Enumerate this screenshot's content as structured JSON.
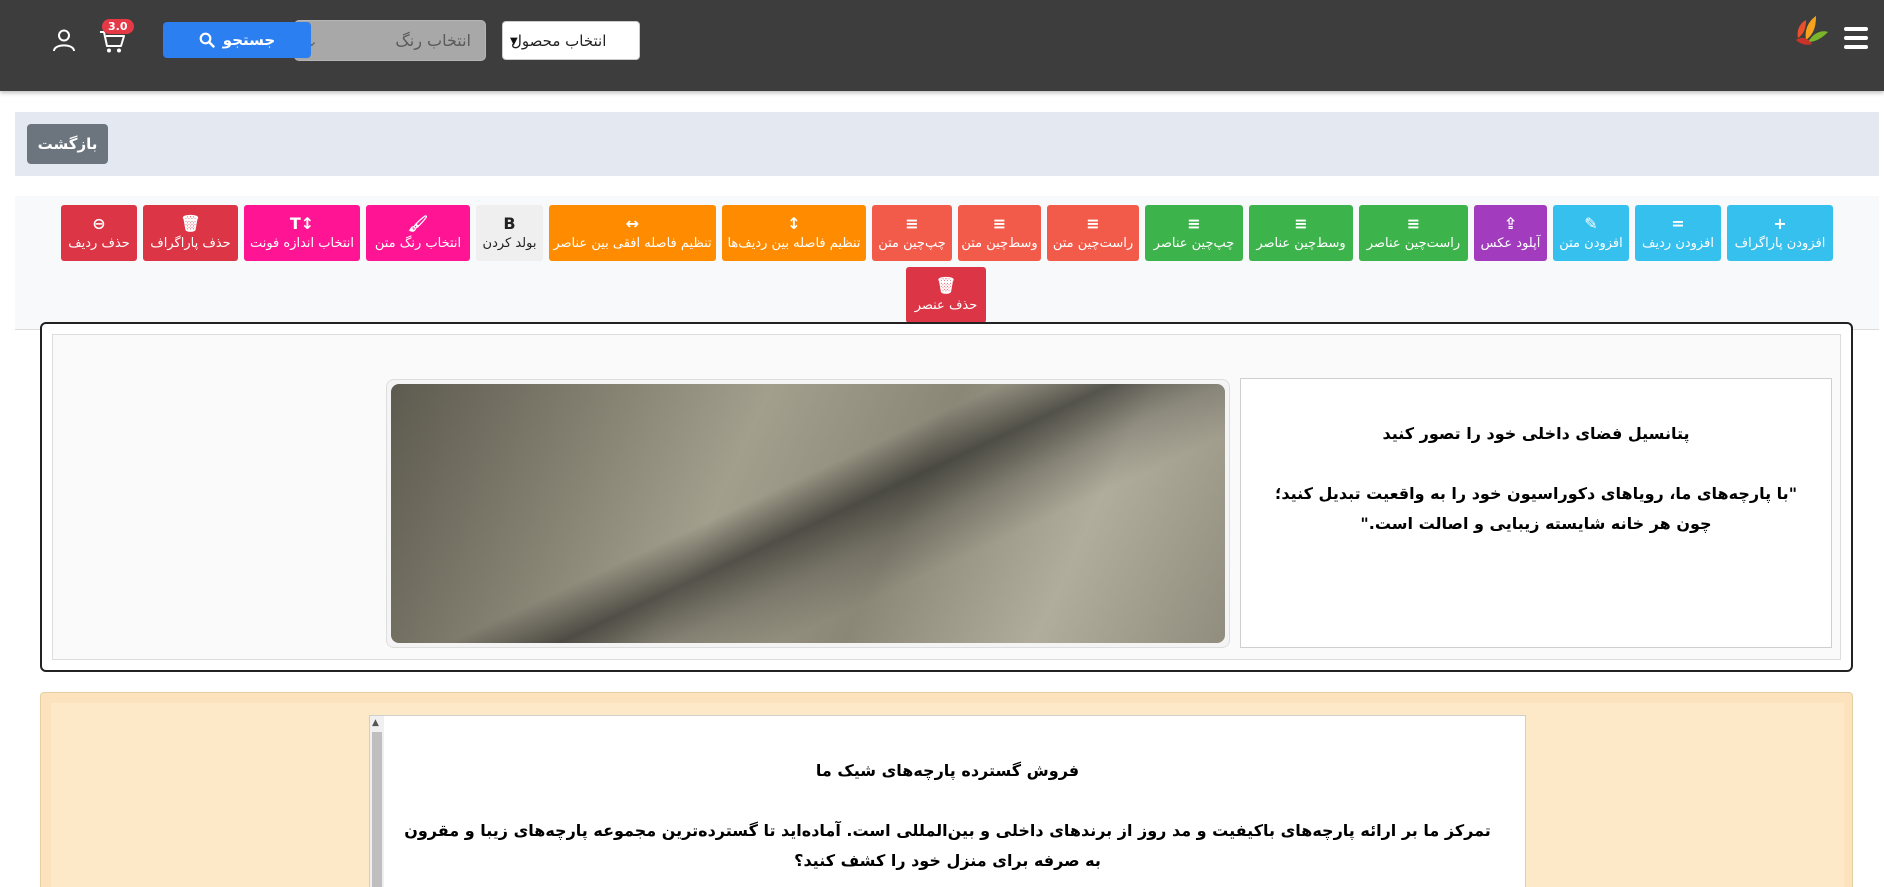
{
  "navbar": {
    "product_select": "انتخاب محصول",
    "color_select": "انتخاب رنگ",
    "search_label": "جستجو",
    "cart_badge": "3.0",
    "icons": [
      "hamburger-icon",
      "logo",
      "search-icon",
      "cart-icon",
      "user-icon"
    ]
  },
  "back_label": "بازگشت",
  "toolbar": {
    "row1": [
      {
        "label": "افزودن پاراگراف",
        "icon": "+",
        "color": "info"
      },
      {
        "label": "افزودن ردیف",
        "icon": "=",
        "color": "info"
      },
      {
        "label": "افزودن متن",
        "icon": "✎",
        "color": "info"
      },
      {
        "label": "آپلود عکس",
        "icon": "⇪",
        "color": "purple"
      },
      {
        "label": "راست‌چین عناصر",
        "icon": "≡",
        "color": "green"
      },
      {
        "label": "وسط‌چین عناصر",
        "icon": "≡",
        "color": "green"
      },
      {
        "label": "چپ‌چین عناصر",
        "icon": "≡",
        "color": "green"
      },
      {
        "label": "راست‌چین متن",
        "icon": "≡",
        "color": "tomato"
      },
      {
        "label": "وسط‌چین متن",
        "icon": "≡",
        "color": "tomato"
      },
      {
        "label": "چپ‌چین متن",
        "icon": "≡",
        "color": "tomato"
      },
      {
        "label": "تنظیم فاصله بین ردیف‌ها",
        "icon": "↕",
        "color": "orange"
      },
      {
        "label": "تنظیم فاصله افقی بین عناصر",
        "icon": "↔",
        "color": "orange"
      },
      {
        "label": "بولد کردن",
        "icon": "B",
        "color": "light"
      },
      {
        "label": "انتخاب رنگ متن",
        "icon": "🖌",
        "color": "pink"
      },
      {
        "label": "انتخاب اندازه فونت",
        "icon": "T↕",
        "color": "pink"
      },
      {
        "label": "حذف پاراگراف",
        "icon": "🗑",
        "color": "red"
      },
      {
        "label": "حذف ردیف",
        "icon": "⊖",
        "color": "red"
      }
    ],
    "row2": [
      {
        "label": "حذف عنصر",
        "icon": "🗑",
        "color": "red"
      }
    ]
  },
  "row1": {
    "title": "پتانسیل فضای داخلی خود را تصور کنید",
    "body": "\"با پارچه‌های ما، رویاهای دکوراسیون خود را به واقعیت تبدیل کنید؛ چون هر خانه شایسته زیبایی و اصالت است.\""
  },
  "row2": {
    "title": "فروش گسترده پارچه‌های شیک ما",
    "body": "تمرکز ما بر ارائه پارچه‌های باکیفیت و مد روز از برندهای داخلی و بین‌المللی است. آماده‌اید تا گسترده‌ترین مجموعه پارچه‌های زیبا و مقرون به صرفه برای منزل خود را کشف کنید؟"
  },
  "colors": {
    "navbar": "#3d3d3d",
    "primary": "#2c7ff0",
    "info": "#35c0ee",
    "purple": "#a33bbe",
    "green": "#3cb44b",
    "tomato": "#f25b4a",
    "orange": "#ff8c00",
    "pink": "#ff1493",
    "red": "#dc3545",
    "row2_bg": "#fde3bd"
  }
}
